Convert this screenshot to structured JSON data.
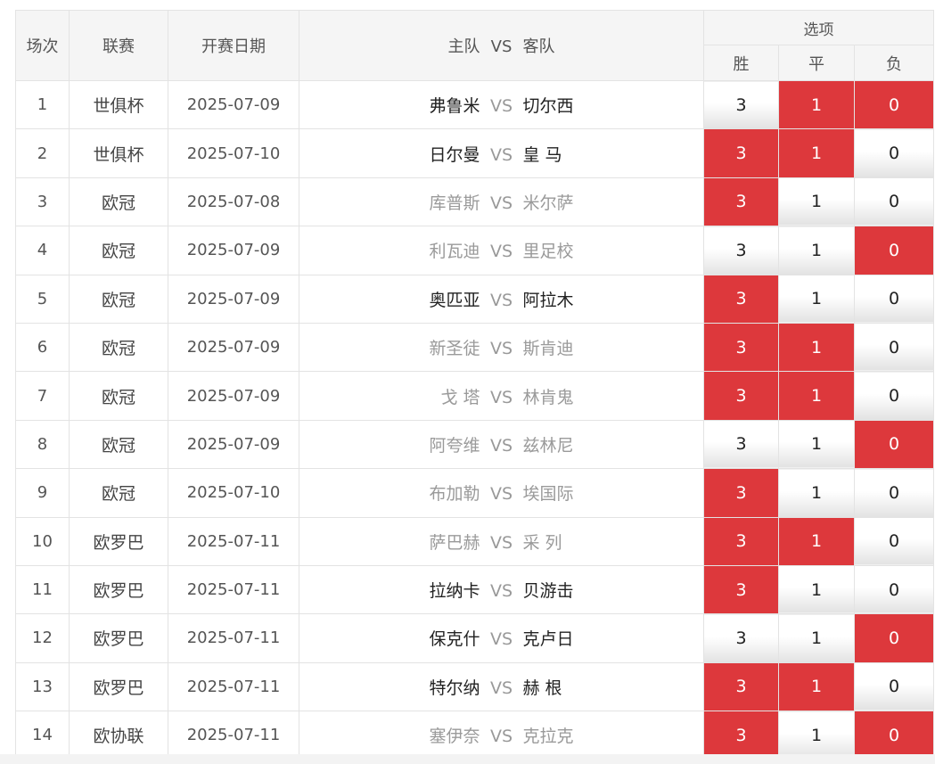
{
  "headers": {
    "index": "场次",
    "league": "联赛",
    "date": "开赛日期",
    "home": "主队",
    "vs": "VS",
    "away": "客队",
    "options": "选项",
    "win": "胜",
    "draw": "平",
    "lose": "负"
  },
  "colors": {
    "selected": "#dd383c",
    "header_bg": "#f5f5f5"
  },
  "matches": [
    {
      "idx": "1",
      "league": "世俱杯",
      "date": "2025-07-09",
      "home": "弗鲁米",
      "vs": "VS",
      "away": "切尔西",
      "home_style": "dark",
      "away_style": "dark",
      "win": "3",
      "draw": "1",
      "lose": "0",
      "win_sel": false,
      "draw_sel": true,
      "lose_sel": true
    },
    {
      "idx": "2",
      "league": "世俱杯",
      "date": "2025-07-10",
      "home": "日尔曼",
      "vs": "VS",
      "away": "皇 马",
      "home_style": "dark",
      "away_style": "dark",
      "win": "3",
      "draw": "1",
      "lose": "0",
      "win_sel": true,
      "draw_sel": true,
      "lose_sel": false
    },
    {
      "idx": "3",
      "league": "欧冠",
      "date": "2025-07-08",
      "home": "库普斯",
      "vs": "VS",
      "away": "米尔萨",
      "home_style": "grey",
      "away_style": "grey",
      "win": "3",
      "draw": "1",
      "lose": "0",
      "win_sel": true,
      "draw_sel": false,
      "lose_sel": false
    },
    {
      "idx": "4",
      "league": "欧冠",
      "date": "2025-07-09",
      "home": "利瓦迪",
      "vs": "VS",
      "away": "里足校",
      "home_style": "grey",
      "away_style": "grey",
      "win": "3",
      "draw": "1",
      "lose": "0",
      "win_sel": false,
      "draw_sel": false,
      "lose_sel": true
    },
    {
      "idx": "5",
      "league": "欧冠",
      "date": "2025-07-09",
      "home": "奥匹亚",
      "vs": "VS",
      "away": "阿拉木",
      "home_style": "dark",
      "away_style": "dark",
      "win": "3",
      "draw": "1",
      "lose": "0",
      "win_sel": true,
      "draw_sel": false,
      "lose_sel": false
    },
    {
      "idx": "6",
      "league": "欧冠",
      "date": "2025-07-09",
      "home": "新圣徒",
      "vs": "VS",
      "away": "斯肯迪",
      "home_style": "grey",
      "away_style": "grey",
      "win": "3",
      "draw": "1",
      "lose": "0",
      "win_sel": true,
      "draw_sel": true,
      "lose_sel": false
    },
    {
      "idx": "7",
      "league": "欧冠",
      "date": "2025-07-09",
      "home": "戈 塔",
      "vs": "VS",
      "away": "林肯鬼",
      "home_style": "grey",
      "away_style": "grey",
      "win": "3",
      "draw": "1",
      "lose": "0",
      "win_sel": true,
      "draw_sel": true,
      "lose_sel": false
    },
    {
      "idx": "8",
      "league": "欧冠",
      "date": "2025-07-09",
      "home": "阿夸维",
      "vs": "VS",
      "away": "兹林尼",
      "home_style": "grey",
      "away_style": "grey",
      "win": "3",
      "draw": "1",
      "lose": "0",
      "win_sel": false,
      "draw_sel": false,
      "lose_sel": true
    },
    {
      "idx": "9",
      "league": "欧冠",
      "date": "2025-07-10",
      "home": "布加勒",
      "vs": "VS",
      "away": "埃国际",
      "home_style": "grey",
      "away_style": "grey",
      "win": "3",
      "draw": "1",
      "lose": "0",
      "win_sel": true,
      "draw_sel": false,
      "lose_sel": false
    },
    {
      "idx": "10",
      "league": "欧罗巴",
      "date": "2025-07-11",
      "home": "萨巴赫",
      "vs": "VS",
      "away": "采 列",
      "home_style": "grey",
      "away_style": "grey",
      "win": "3",
      "draw": "1",
      "lose": "0",
      "win_sel": true,
      "draw_sel": true,
      "lose_sel": false
    },
    {
      "idx": "11",
      "league": "欧罗巴",
      "date": "2025-07-11",
      "home": "拉纳卡",
      "vs": "VS",
      "away": "贝游击",
      "home_style": "dark",
      "away_style": "dark",
      "win": "3",
      "draw": "1",
      "lose": "0",
      "win_sel": true,
      "draw_sel": false,
      "lose_sel": false
    },
    {
      "idx": "12",
      "league": "欧罗巴",
      "date": "2025-07-11",
      "home": "保克什",
      "vs": "VS",
      "away": "克卢日",
      "home_style": "dark",
      "away_style": "dark",
      "win": "3",
      "draw": "1",
      "lose": "0",
      "win_sel": false,
      "draw_sel": false,
      "lose_sel": true
    },
    {
      "idx": "13",
      "league": "欧罗巴",
      "date": "2025-07-11",
      "home": "特尔纳",
      "vs": "VS",
      "away": "赫 根",
      "home_style": "dark",
      "away_style": "dark",
      "win": "3",
      "draw": "1",
      "lose": "0",
      "win_sel": true,
      "draw_sel": true,
      "lose_sel": false
    },
    {
      "idx": "14",
      "league": "欧协联",
      "date": "2025-07-11",
      "home": "塞伊奈",
      "vs": "VS",
      "away": "克拉克",
      "home_style": "grey",
      "away_style": "grey",
      "win": "3",
      "draw": "1",
      "lose": "0",
      "win_sel": true,
      "draw_sel": false,
      "lose_sel": true
    }
  ]
}
